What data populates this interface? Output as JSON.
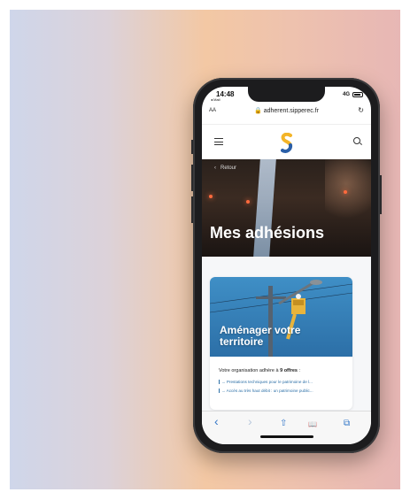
{
  "status": {
    "time": "14:48",
    "back_app": "◂ Mail",
    "network": "4G"
  },
  "browser": {
    "text_size": "AA",
    "url": "adherent.sipperec.fr",
    "reload_icon": "reload-icon"
  },
  "header": {
    "menu_icon": "hamburger-icon",
    "search_icon": "search-icon"
  },
  "hero": {
    "back_label": "Retour",
    "title": "Mes adhésions"
  },
  "card": {
    "title": "Aménager votre territoire",
    "intro_prefix": "Votre organisation adhère à ",
    "intro_count": "9 offres",
    "intro_suffix": " :",
    "offers": [
      "Prestations techniques pour le patrimoine de l...",
      "Accès au très haut débit : un patrimoine public..."
    ]
  },
  "toolbar": {
    "back": "‹",
    "forward": "›",
    "share": "⇧",
    "bookmarks": "📖",
    "tabs": "⧉"
  },
  "colors": {
    "accent": "#2c6fa7",
    "logo_blue": "#2a5fa8",
    "logo_yellow": "#f3b428"
  }
}
